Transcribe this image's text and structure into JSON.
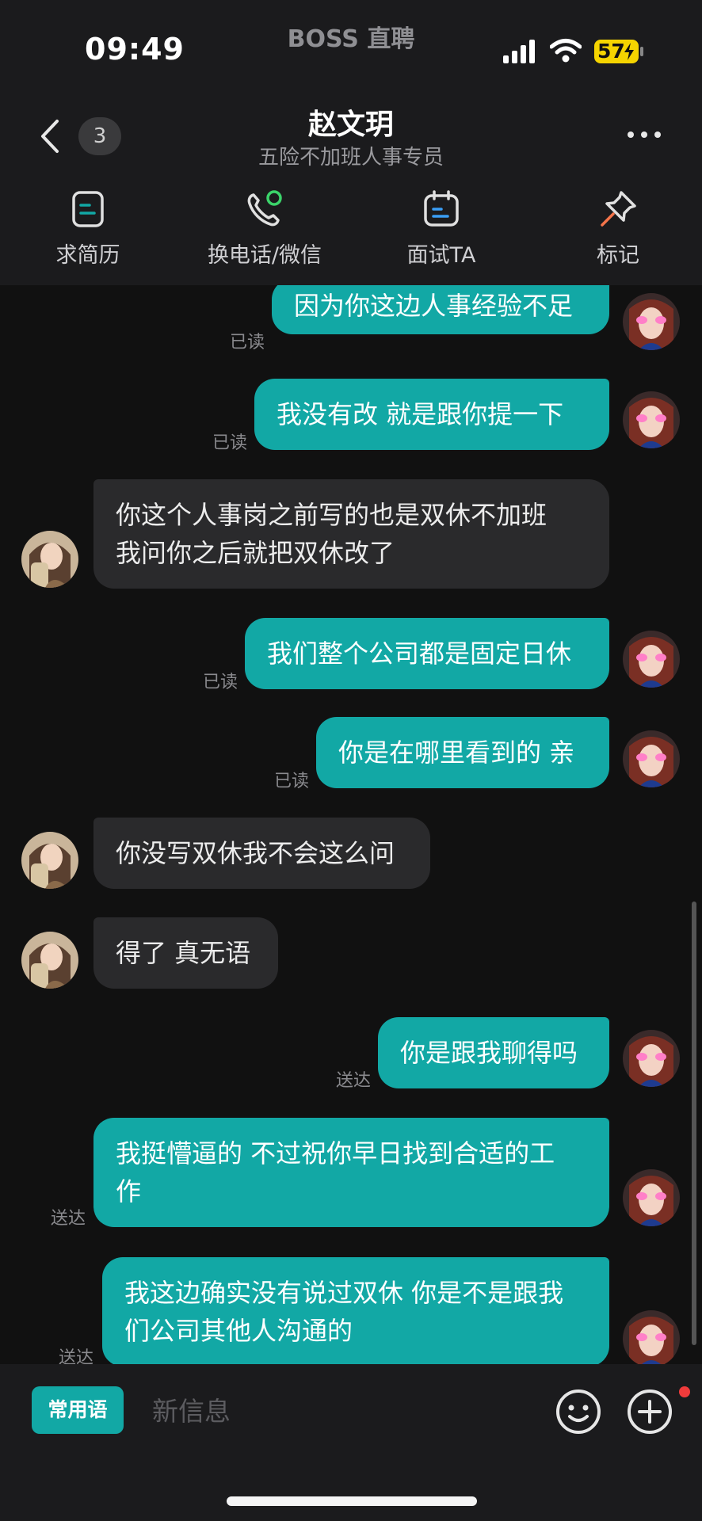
{
  "status_bar": {
    "time": "09:49",
    "app_name": "BOSS 直聘",
    "battery": "57"
  },
  "header": {
    "back_icon": "chevron-left-icon",
    "unread_count": "3",
    "contact_name": "赵文玥",
    "contact_title": "五险不加班人事专员",
    "more_icon": "more-dots-icon"
  },
  "actions": [
    {
      "label": "求简历",
      "icon": "resume-icon"
    },
    {
      "label": "换电话/微信",
      "icon": "phone-wechat-icon"
    },
    {
      "label": "面试TA",
      "icon": "calendar-icon"
    },
    {
      "label": "标记",
      "icon": "pin-icon"
    }
  ],
  "messages": [
    {
      "side": "out",
      "text": "因为你这边人事经验不足",
      "status": "已读"
    },
    {
      "side": "out",
      "text": "我没有改  就是跟你提一下",
      "status": "已读"
    },
    {
      "side": "in",
      "lines": [
        "你这个人事岗之前写的也是双休不加班",
        "我问你之后就把双休改了"
      ]
    },
    {
      "side": "out",
      "text": "我们整个公司都是固定日休",
      "status": "已读"
    },
    {
      "side": "out",
      "text": "你是在哪里看到的 亲",
      "status": "已读"
    },
    {
      "side": "in",
      "text": "你没写双休我不会这么问"
    },
    {
      "side": "in",
      "text": "得了 真无语"
    },
    {
      "side": "out",
      "text": "你是跟我聊得吗",
      "status": "送达"
    },
    {
      "side": "out",
      "lines": [
        "我挺懵逼的  不过祝你早日找到合适的工",
        "作"
      ],
      "status": "送达"
    },
    {
      "side": "out",
      "lines": [
        "我这边确实没有说过双休 你是不是跟我",
        "们公司其他人沟通的"
      ],
      "status": "送达"
    }
  ],
  "input_bar": {
    "phrases_label": "常用语",
    "placeholder": "新信息",
    "emoji_icon": "emoji-icon",
    "plus_icon": "plus-icon"
  },
  "colors": {
    "accent": "#12a8a5",
    "background": "#111111",
    "incoming_bubble": "#2a2a2c",
    "badge_red": "#f13b3b"
  }
}
